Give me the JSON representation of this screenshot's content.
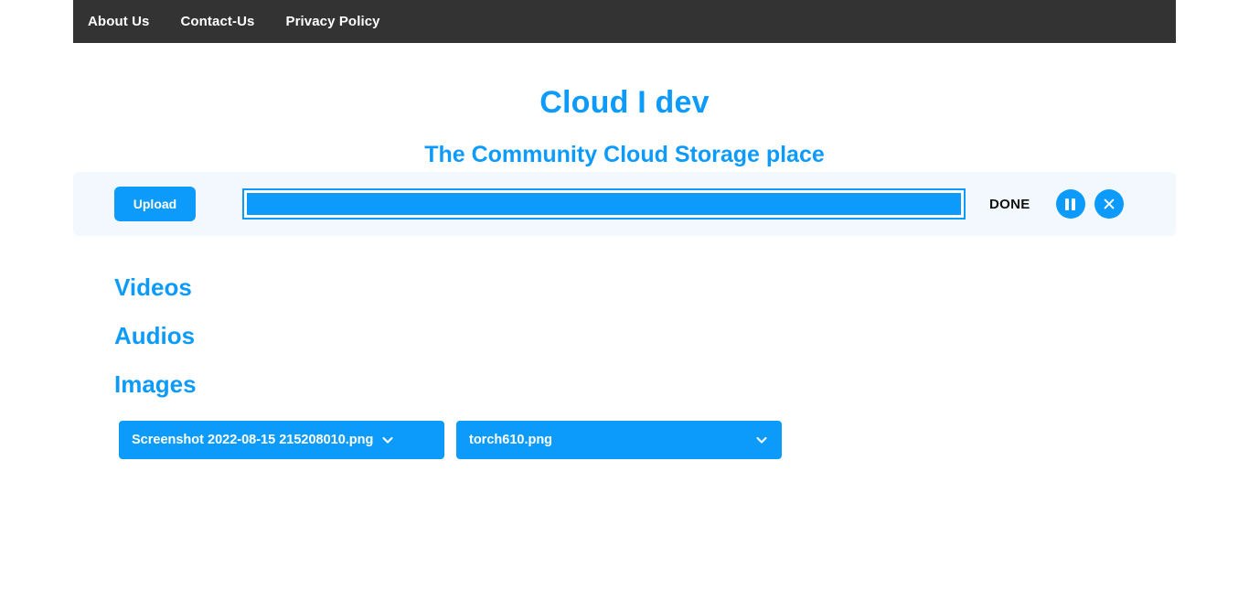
{
  "nav": {
    "items": [
      {
        "label": "About Us"
      },
      {
        "label": "Contact-Us"
      },
      {
        "label": "Privacy Policy"
      }
    ]
  },
  "header": {
    "title": "Cloud I dev",
    "subtitle": "The Community Cloud Storage place"
  },
  "upload": {
    "button_label": "Upload",
    "progress_percent": 100,
    "status": "DONE",
    "pause_icon": "pause-icon",
    "close_icon": "close-icon"
  },
  "sections": [
    {
      "heading": "Videos",
      "files": []
    },
    {
      "heading": "Audios",
      "files": []
    },
    {
      "heading": "Images",
      "files": [
        {
          "name": "Screenshot 2022-08-15 215208010.png",
          "chevron_icon": "chevron-down-icon"
        },
        {
          "name": "torch610.png",
          "chevron_icon": "chevron-down-icon"
        }
      ]
    }
  ],
  "colors": {
    "accent": "#0d9bfb",
    "navbar": "#333333",
    "panel": "#f2f8fe",
    "text_dark": "#111111"
  }
}
